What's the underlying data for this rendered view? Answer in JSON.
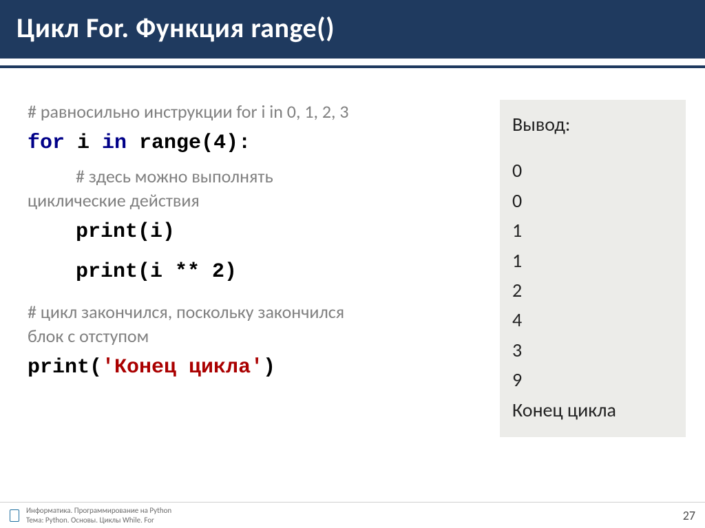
{
  "header": {
    "title": "Цикл For. Функция range()"
  },
  "code": {
    "comment1": "# равносильно инструкции for i in 0, 1, 2, 3",
    "line_for_pre": "for",
    "line_for_mid": " i ",
    "line_for_in": "in",
    "line_for_post": " range(4):",
    "comment2_a": "# здесь можно выполнять",
    "comment2_b": "циклические действия",
    "line_print1": "print(i)",
    "line_print2": "print(i ** 2)",
    "comment3_a": "# цикл закончился, поскольку закончился",
    "comment3_b": "блок с отступом",
    "line_print3_pre": "print(",
    "line_print3_str": "'Конец цикла'",
    "line_print3_post": ")"
  },
  "output": {
    "title": "Вывод:",
    "lines": [
      "0",
      "0",
      "1",
      "1",
      "2",
      "4",
      "3",
      "9",
      "Конец цикла"
    ]
  },
  "footer": {
    "line1": "Информатика. Программирование на Python",
    "line2": "Тема: Python. Основы. Циклы While. For",
    "page": "27"
  }
}
